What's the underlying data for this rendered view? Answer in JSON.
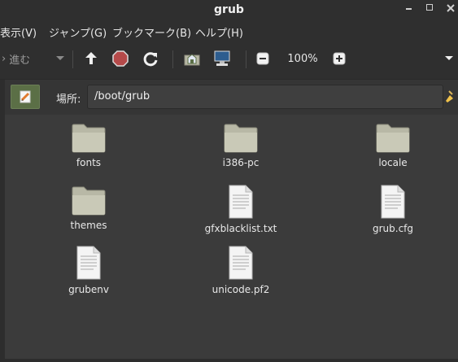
{
  "window": {
    "title": "grub"
  },
  "menubar": {
    "items": [
      "表示(V)",
      "ジャンプ(G)",
      "ブックマーク(B)",
      "ヘルプ(H)"
    ]
  },
  "toolbar": {
    "forward_label": "進む",
    "zoom": "100%"
  },
  "location": {
    "label": "場所:",
    "path": "/boot/grub"
  },
  "files": [
    {
      "name": "fonts",
      "type": "folder"
    },
    {
      "name": "i386-pc",
      "type": "folder"
    },
    {
      "name": "locale",
      "type": "folder"
    },
    {
      "name": "themes",
      "type": "folder"
    },
    {
      "name": "gfxblacklist.txt",
      "type": "file"
    },
    {
      "name": "grub.cfg",
      "type": "file"
    },
    {
      "name": "grubenv",
      "type": "file"
    },
    {
      "name": "unicode.pf2",
      "type": "file"
    }
  ],
  "colors": {
    "accent": "#5b6f46",
    "stop": "#b54a4a",
    "folder": "#b8b8a6"
  }
}
